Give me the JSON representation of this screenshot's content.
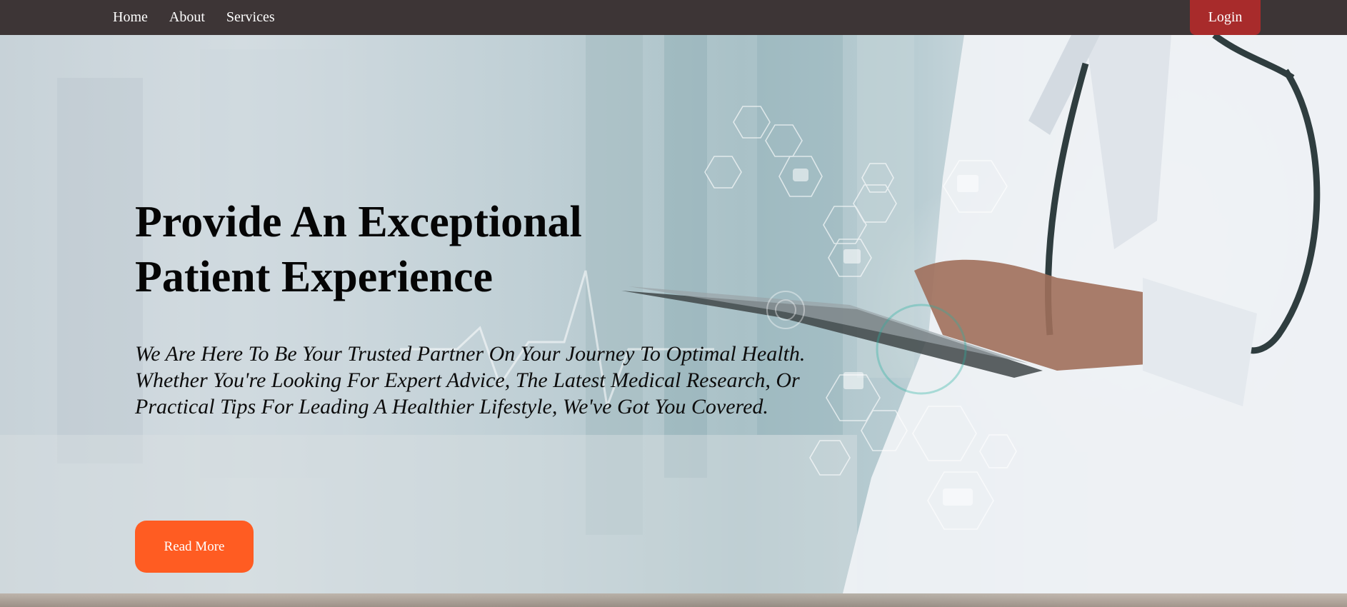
{
  "nav": {
    "links": [
      "Home",
      "About",
      "Services"
    ],
    "login_label": "Login"
  },
  "hero": {
    "title_line1": "Provide An Exceptional",
    "title_line2": "Patient Experience",
    "subtitle": "We Are Here To Be Your Trusted Partner On Your Journey To Optimal Health. Whether You're Looking For Expert Advice, The Latest Medical Research, Or Practical Tips For Leading A Healthier Lifestyle, We've Got You Covered.",
    "button_label": "Read More",
    "background_image": "doctor-with-tablet-medical-icons"
  },
  "colors": {
    "navbar": "#3d3536",
    "login_button": "#a82b2b",
    "read_more_button": "#ff5c22",
    "text_dark": "#050505"
  }
}
